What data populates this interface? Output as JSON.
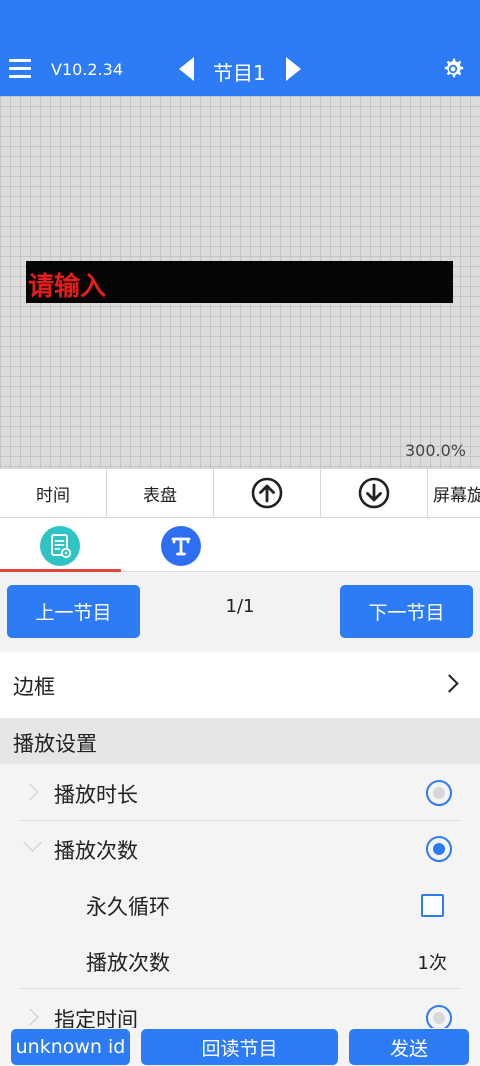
{
  "header": {
    "version": "V10.2.34",
    "title": "节目1",
    "icons": {
      "menu": "menu-icon",
      "prev": "chevron-left-icon",
      "next": "chevron-right-icon",
      "settings": "gear-icon"
    },
    "background": "#2e7bf6"
  },
  "canvas": {
    "led_text": "请输入",
    "led_text_color": "#e51c1c",
    "zoom": "300.0%"
  },
  "toolbar": {
    "time_label": "时间",
    "dial_label": "表盘",
    "up_icon": "arrow-up-circle-icon",
    "down_icon": "arrow-down-circle-icon",
    "screen_label": "屏幕旋"
  },
  "tabs": [
    {
      "icon": "document-settings-icon",
      "color": "#2fc3c4",
      "active": true
    },
    {
      "icon": "text-icon",
      "color": "#2e6ff1",
      "active": false
    }
  ],
  "nav": {
    "prev_label": "上一节目",
    "page": "1/1",
    "next_label": "下一节目"
  },
  "border": {
    "label": "边框"
  },
  "play_settings": {
    "title": "播放设置",
    "options": [
      {
        "label": "播放时长",
        "selected": false
      },
      {
        "label": "播放次数",
        "selected": true
      },
      {
        "label": "指定时间",
        "selected": false
      }
    ],
    "sub": {
      "loop_label": "永久循环",
      "loop_checked": false,
      "count_label": "播放次数",
      "count_value": "1次"
    }
  },
  "bottom": {
    "id_label": "unknown id",
    "readback_label": "回读节目",
    "send_label": "发送"
  }
}
